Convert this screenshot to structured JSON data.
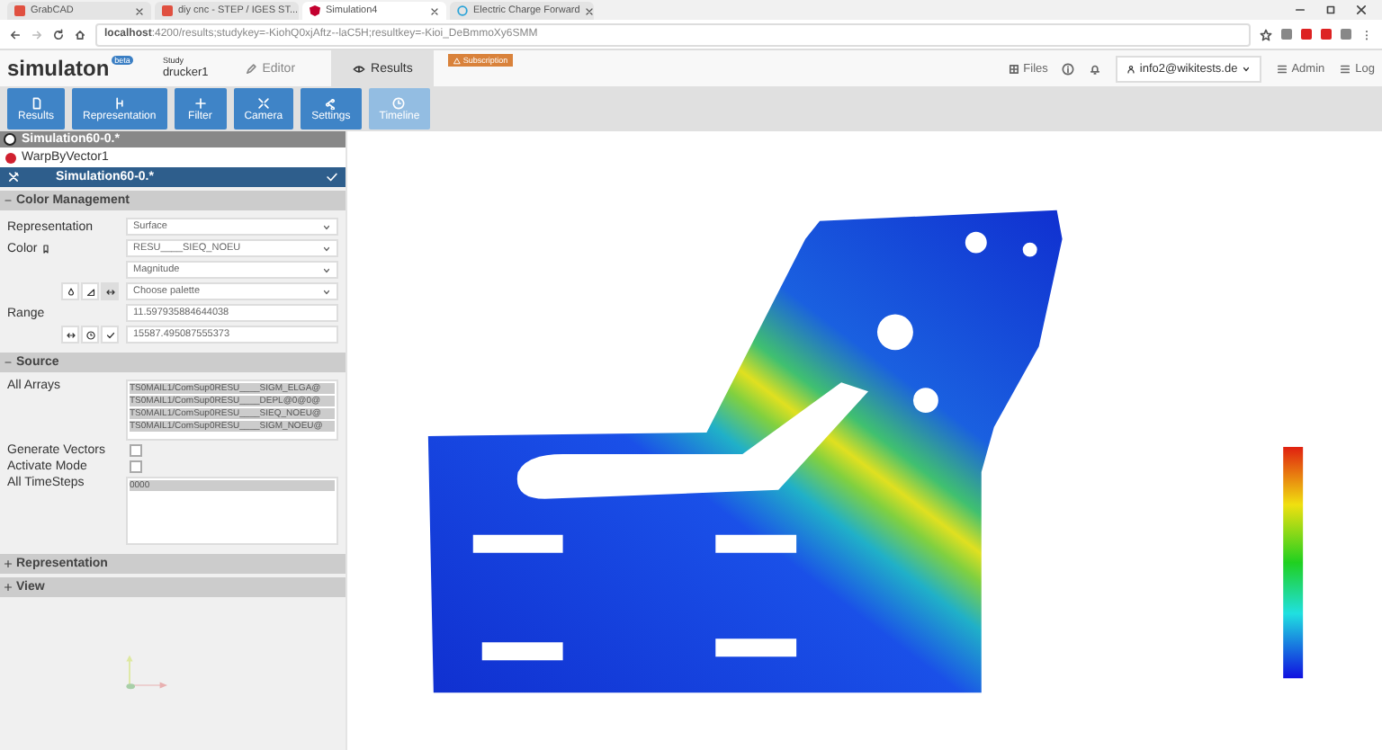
{
  "browser": {
    "tabs": [
      {
        "label": "GrabCAD",
        "selected": false
      },
      {
        "label": "diy cnc - STEP / IGES ST...",
        "selected": false
      },
      {
        "label": "Simulation4",
        "selected": true
      },
      {
        "label": "Electric Charge Forward",
        "selected": false
      }
    ],
    "address": {
      "host": "localhost",
      "path": ":4200/results;studykey=-KiohQ0xjAftz--laC5H;resultkey=-Kioi_DeBmmoXy6SMM"
    }
  },
  "header": {
    "logo": "simulaton",
    "logo_badge": "beta",
    "study_label": "Study",
    "study_name": "drucker1",
    "tabs": [
      {
        "label": "Editor",
        "selected": false
      },
      {
        "label": "Results",
        "selected": true
      }
    ],
    "notice": "Subscription",
    "right": [
      {
        "kind": "link",
        "label": "Files"
      },
      {
        "kind": "icon"
      },
      {
        "kind": "icon"
      },
      {
        "kind": "account",
        "label": "info2@wikitests.de"
      },
      {
        "kind": "link",
        "label": "Admin"
      },
      {
        "kind": "link",
        "label": "Log"
      }
    ]
  },
  "toolbar": [
    {
      "label": "Results",
      "disabled": false
    },
    {
      "label": "Representation",
      "disabled": false
    },
    {
      "label": "Filter",
      "disabled": false
    },
    {
      "label": "Camera",
      "disabled": false
    },
    {
      "label": "Settings",
      "disabled": false
    },
    {
      "label": "Timeline",
      "disabled": true
    }
  ],
  "pipeline": {
    "root": "Simulation60-0.*",
    "children": [
      {
        "label": "WarpByVector1"
      }
    ]
  },
  "active_item": {
    "label": "Simulation60-0.*"
  },
  "sections": [
    {
      "kind": "color",
      "title": "Color Management",
      "expanded": true,
      "representation_label": "Representation",
      "representation": "Surface",
      "color_label": "Color",
      "color_array": "RESU____SIEQ_NOEU",
      "component": "Magnitude",
      "palette": "Choose palette",
      "range_label": "Range",
      "range_min": "11.597935884644038",
      "range_max": "15587.495087555373"
    },
    {
      "kind": "source",
      "title": "Source",
      "expanded": true,
      "arrays_label": "All Arrays",
      "arrays": [
        "TS0MAIL1/ComSup0RESU____SIGM_ELGA@",
        "TS0MAIL1/ComSup0RESU____DEPL@0@0@",
        "TS0MAIL1/ComSup0RESU____SIEQ_NOEU@",
        "TS0MAIL1/ComSup0RESU____SIGM_NOEU@"
      ],
      "checks": [
        {
          "label": "Generate Vectors",
          "checked": false
        },
        {
          "label": "Activate Mode",
          "checked": false
        }
      ],
      "timesteps_label": "All TimeSteps",
      "timesteps": [
        "0000"
      ]
    },
    {
      "kind": "plain",
      "title": "Representation",
      "expanded": false
    },
    {
      "kind": "plain",
      "title": "View",
      "expanded": false
    }
  ]
}
